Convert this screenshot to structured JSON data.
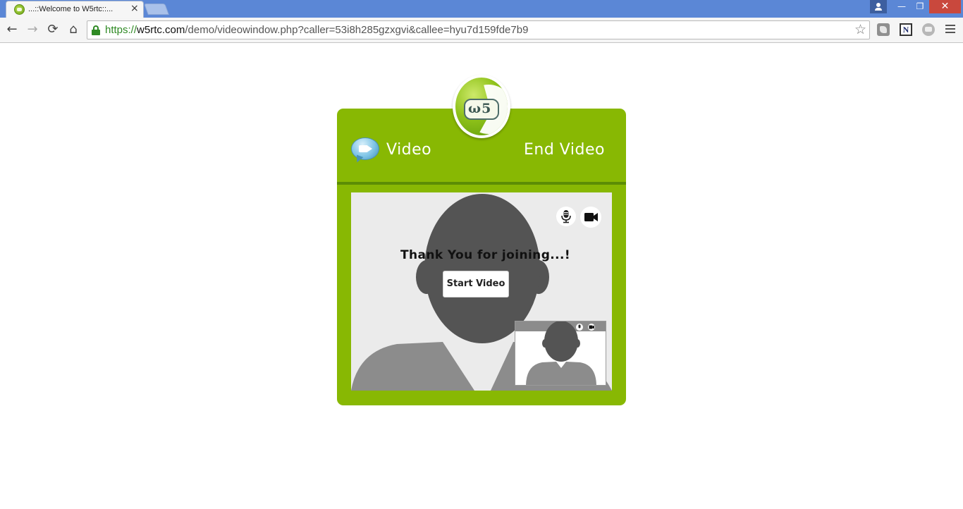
{
  "browser": {
    "tab": {
      "title": "...::Welcome to W5rtc::...",
      "close": "×"
    },
    "window_controls": {
      "minimize": "—",
      "maximize": "❐",
      "close": "✕"
    },
    "nav": {
      "back": "←",
      "forward": "→",
      "reload": "⟳",
      "home": "⌂"
    },
    "address_bar": {
      "scheme": "https://",
      "host": "w5rtc.com",
      "path": "/demo/videowindow.php?caller=53i8h285gzxgvi&callee=hyu7d159fde7b9"
    },
    "bookmark": "☆",
    "extensions": [
      "extension-1-icon",
      "n-extension-icon",
      "extension-3-icon"
    ]
  },
  "page": {
    "logo_text": "ω5",
    "header": {
      "title": "Video",
      "end_video_label": "End Video"
    },
    "stage": {
      "message": "Thank You for joining...!",
      "start_button_label": "Start Video"
    },
    "icons": {
      "chat": "video-chat-icon",
      "mic": "microphone-icon",
      "camera": "video-camera-icon"
    },
    "colors": {
      "panel": "#88b803",
      "panel_divider": "#5c8d05",
      "stage_bg": "#ebebeb",
      "avatar_head": "#545454",
      "avatar_body": "#8c8c8c"
    }
  }
}
